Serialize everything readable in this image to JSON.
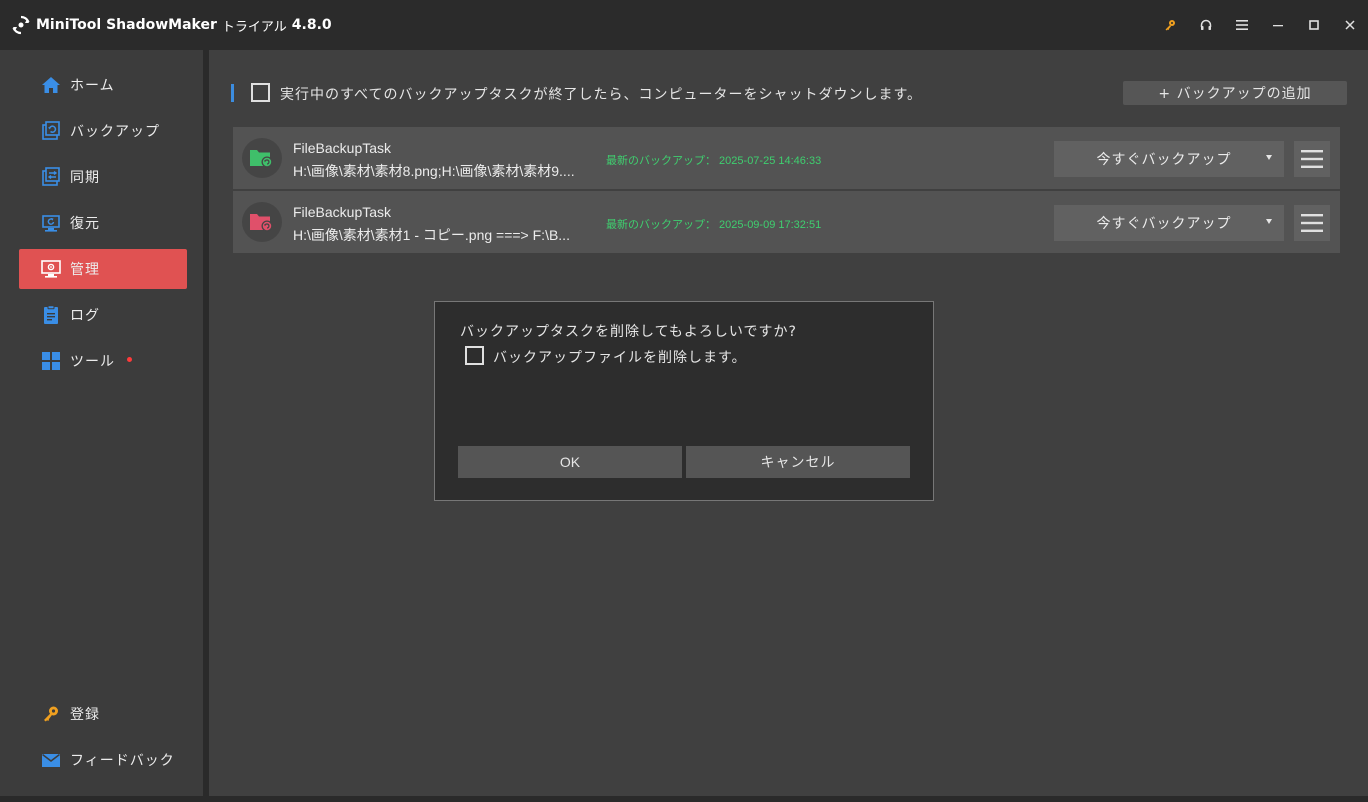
{
  "titlebar": {
    "app_name": "MiniTool ShadowMaker",
    "edition": "トライアル",
    "version": "4.8.0"
  },
  "sidebar": {
    "items": [
      {
        "label": "ホーム",
        "icon": "home-icon"
      },
      {
        "label": "バックアップ",
        "icon": "backup-icon"
      },
      {
        "label": "同期",
        "icon": "sync-icon"
      },
      {
        "label": "復元",
        "icon": "restore-icon"
      },
      {
        "label": "管理",
        "icon": "manage-icon",
        "active": true
      },
      {
        "label": "ログ",
        "icon": "log-icon"
      },
      {
        "label": "ツール",
        "icon": "tools-icon",
        "badge": "red-dot"
      }
    ],
    "bottom": [
      {
        "label": "登録",
        "icon": "key-icon"
      },
      {
        "label": "フィードバック",
        "icon": "mail-icon"
      }
    ]
  },
  "main": {
    "shutdown_text": "実行中のすべてのバックアップタスクが終了したら、コンピューターをシャットダウンします。",
    "add_backup_label": "+ バックアップの追加",
    "tasks": [
      {
        "name": "FileBackupTask",
        "path": "H:\\画像\\素材\\素材8.png;H:\\画像\\素材\\素材9....",
        "latest": "最新のバックアップ： 2025-07-25 14:46:33",
        "action_label": "今すぐバックアップ",
        "icon_color": "#3fbf6a"
      },
      {
        "name": "FileBackupTask",
        "path": "H:\\画像\\素材\\素材1 - コピー.png ===> F:\\B...",
        "latest": "最新のバックアップ： 2025-09-09 17:32:51",
        "action_label": "今すぐバックアップ",
        "icon_color": "#e0506a"
      }
    ]
  },
  "dialog": {
    "question": "バックアップタスクを削除してもよろしいですか?",
    "checkbox_label": "バックアップファイルを削除します。",
    "ok_label": "OK",
    "cancel_label": "キャンセル"
  },
  "colors": {
    "accent_active": "#e05252",
    "accent_bar": "#3c8de0",
    "latest_text": "#3fcf6f",
    "key_icon": "#f0a020"
  }
}
